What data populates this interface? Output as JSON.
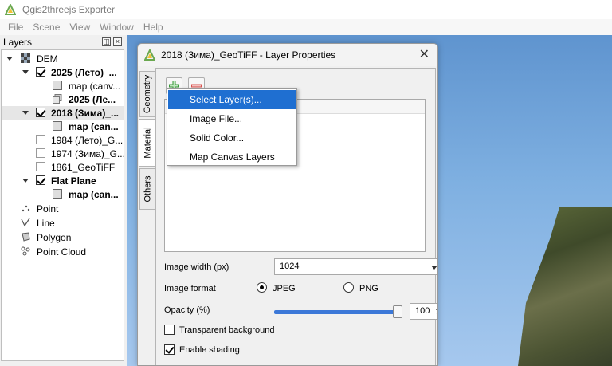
{
  "window": {
    "title": "Qgis2threejs Exporter",
    "icon": "qgis-triangle-icon"
  },
  "menu": [
    "File",
    "Scene",
    "View",
    "Window",
    "Help"
  ],
  "layers_panel": {
    "title": "Layers",
    "items": [
      {
        "label": "DEM",
        "icon": "dem-grid-icon"
      },
      {
        "label": "2025 (Лето)_...",
        "checked": true
      },
      {
        "label": "map (canv..."
      },
      {
        "label": "2025 (Ле..."
      },
      {
        "label": "2018 (Зима)_...",
        "checked": true
      },
      {
        "label": "map (can..."
      },
      {
        "label": "1984 (Лето)_G...",
        "checked": false
      },
      {
        "label": "1974 (Зима)_G...",
        "checked": false
      },
      {
        "label": "1861_GeoTiFF",
        "checked": false
      },
      {
        "label": "Flat Plane",
        "checked": true
      },
      {
        "label": "map (can..."
      },
      {
        "label": "Point",
        "icon": "point-icon"
      },
      {
        "label": "Line",
        "icon": "line-icon"
      },
      {
        "label": "Polygon",
        "icon": "polygon-icon"
      },
      {
        "label": "Point Cloud",
        "icon": "point-cloud-icon"
      }
    ]
  },
  "dialog": {
    "title": "2018 (Зима)_GeoTiFF - Layer Properties",
    "tabs": [
      "Geometry",
      "Material",
      "Others"
    ],
    "image_width_label": "Image width (px)",
    "image_width_value": "1024",
    "image_format_label": "Image format",
    "format_jpeg": "JPEG",
    "format_png": "PNG",
    "opacity_label": "Opacity (%)",
    "opacity_value": "100",
    "opacity_fraction": 1.0,
    "transparent_label": "Transparent background",
    "shading_label": "Enable shading"
  },
  "popup_menu": {
    "items": [
      "Select Layer(s)...",
      "Image File...",
      "Solid Color...",
      "Map Canvas Layers"
    ],
    "highlighted": 0
  },
  "colors": {
    "accent": "#1f6fd1",
    "slider": "#3c78d8",
    "add_icon": "#3a9a3a",
    "remove_icon": "#d9534f"
  }
}
